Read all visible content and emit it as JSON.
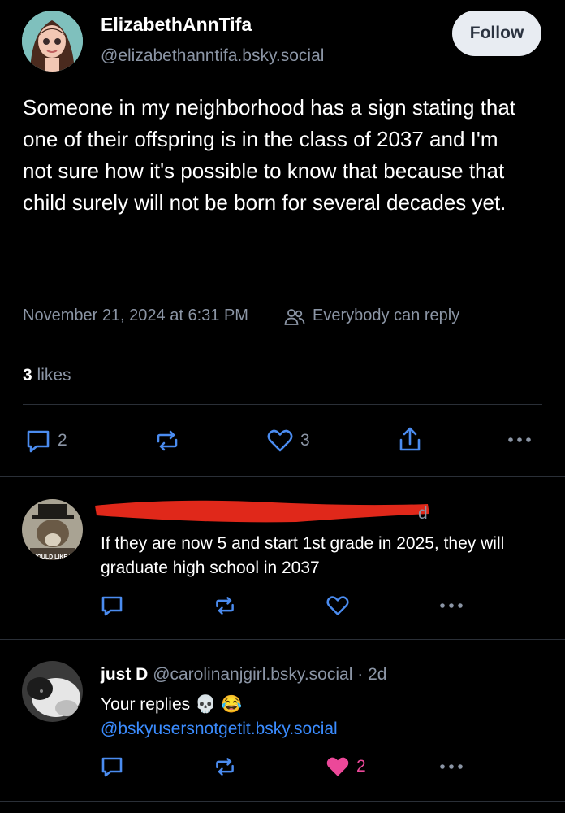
{
  "post": {
    "author_name": "ElizabethAnnTifa",
    "author_handle": "@elizabethanntifa.bsky.social",
    "follow_label": "Follow",
    "text": "Someone in my neighborhood has a sign stating that one of their offspring is in the class of 2037 and I'm not sure how it's possible to know that because that child surely will not be born for several decades yet.",
    "timestamp": "November 21, 2024 at 6:31 PM",
    "reply_setting": "Everybody can reply",
    "likes_count": "3",
    "likes_label": "likes",
    "actions": {
      "reply_count": "2",
      "like_count": "3"
    }
  },
  "replies": [
    {
      "meta_visible": "d",
      "text": "If they are now 5 and start 1st grade in 2025, they will graduate high school in 2037",
      "avatar_caption": "WOULD LIKE T"
    },
    {
      "author_name": "just D",
      "author_handle": "@carolinanjgirl.bsky.social",
      "separator": "·",
      "time": "2d",
      "text": "Your replies",
      "emojis": "💀 😂",
      "mention": "@bskyusersnotgetit.bsky.social",
      "like_count": "2"
    }
  ],
  "colors": {
    "background": "#000000",
    "muted": "#8b95a5",
    "link": "#3b8cff",
    "like_active": "#ec4899",
    "redaction": "#e0281a"
  },
  "icons": [
    "reply-icon",
    "repost-icon",
    "heart-icon",
    "share-icon",
    "more-icon",
    "people-icon"
  ]
}
